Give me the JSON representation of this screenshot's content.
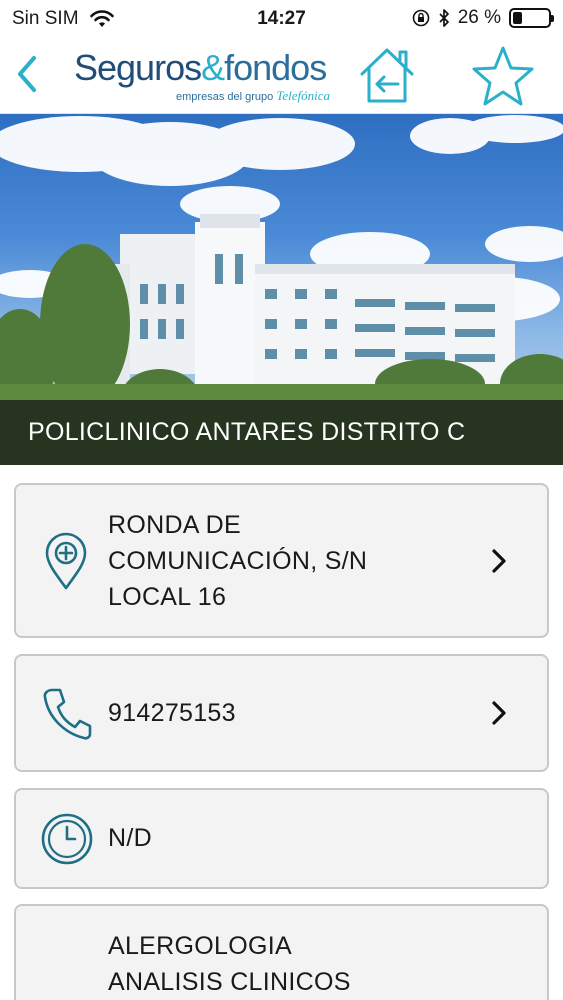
{
  "status_bar": {
    "carrier": "Sin SIM",
    "time": "14:27",
    "battery_percent_label": "26 %",
    "battery_level": 0.26
  },
  "nav": {
    "back_icon": "chevron-left-icon",
    "logo": {
      "word1": "Seguros",
      "ampersand": "&",
      "word2": "fondos",
      "tagline": "empresas del grupo",
      "tagline_brand": "Telefónica"
    },
    "home_icon": "home-back-icon",
    "favorite_icon": "star-icon"
  },
  "hero": {
    "title": "POLICLINICO ANTARES DISTRITO C"
  },
  "address": {
    "lines": [
      "RONDA DE",
      "COMUNICACIÓN, S/N",
      "LOCAL 16"
    ],
    "icon": "location-pin-icon"
  },
  "phone": {
    "number": "914275153",
    "icon": "phone-icon"
  },
  "hours": {
    "value": "N/D",
    "icon": "clock-icon"
  },
  "specialties": {
    "items": [
      "ALERGOLOGIA",
      "ANALISIS CLINICOS"
    ]
  },
  "colors": {
    "accent": "#2bb0c9",
    "icon_teal": "#1e6f86",
    "brand_dark": "#1f4e79",
    "card_bg": "#f3f3f3",
    "card_border": "#c8c8c8"
  }
}
